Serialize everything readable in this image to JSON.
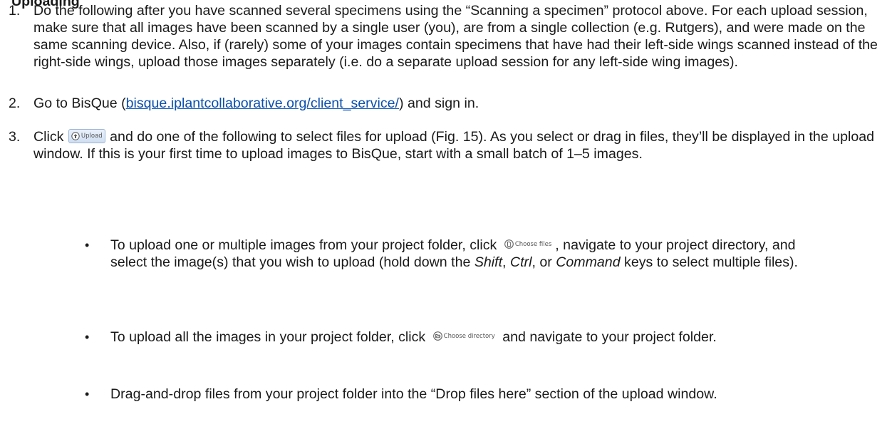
{
  "heading_fragment": "Uploading",
  "steps": [
    {
      "num": "1.",
      "text": "Do the following after you have scanned several specimens using the “Scanning a specimen” protocol above. For each upload session, make sure that all images have been scanned by a single user (you), are from a single collection (e.g. Rutgers), and were made on the same scanning device. Also, if (rarely) some of your images contain specimens that have had their left-side wings scanned instead of the right-side wings, upload those images separately (i.e. do a separate upload session for any left-side wing images)."
    },
    {
      "num": "2.",
      "text_before": "Go to BisQue (",
      "link": "bisque.iplantcollaborative.org/client_service/",
      "text_after": ") and sign in."
    },
    {
      "num": "3.",
      "text_before": "Click",
      "button_label": "Upload",
      "text_after": "and do one of the following to select files for upload (Fig. 15). As you select or drag in files, they’ll be displayed in the upload window. If this is your first time to upload images to BisQue, start with a small batch of 1–5 images."
    }
  ],
  "bullets": [
    {
      "before": "To upload one or multiple images from your project folder, click",
      "button_label": "Choose files",
      "icon": "file-icon",
      "after_a": ", navigate to your project directory, and select the image(s) that you wish to upload (hold down the",
      "key1": "Shift",
      "sep1": ",",
      "key2": "Ctrl",
      "sep2": ", or",
      "key3": "Command",
      "after_b": "keys to select multiple files)."
    },
    {
      "before": "To upload all the images in your project folder, click",
      "button_label": "Choose directory",
      "icon": "folder-open-icon",
      "after": "and navigate to your project folder."
    },
    {
      "text": "Drag-and-drop files from your project folder into the “Drop files here” section of the upload window."
    }
  ]
}
